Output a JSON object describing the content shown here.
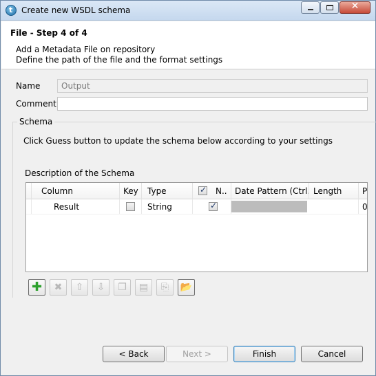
{
  "window": {
    "title": "Create new WSDL schema"
  },
  "header": {
    "title": "File - Step 4 of 4",
    "desc1": "Add a Metadata File on repository",
    "desc2": "Define the path of the file and the format settings"
  },
  "form": {
    "name_label": "Name",
    "name_value": "Output",
    "comment_label": "Comment",
    "comment_value": ""
  },
  "schema": {
    "group_title": "Schema",
    "hint": "Click Guess button to update the schema below according to your settings",
    "desc_label": "Description of the Schema",
    "columns": [
      "Column",
      "Key",
      "Type",
      "N..",
      "Date Pattern (Ctrl...",
      "Length",
      "P"
    ],
    "rows": [
      {
        "column": "Result",
        "key": false,
        "type": "String",
        "nullable": true,
        "date_pattern": "",
        "length": "",
        "precision": "0"
      }
    ]
  },
  "toolbar": {
    "buttons": [
      "add-icon",
      "remove-icon",
      "move-up-icon",
      "move-down-icon",
      "copy-icon",
      "paste-icon",
      "export-icon",
      "import-icon"
    ]
  },
  "buttons": {
    "back": "< Back",
    "next": "Next >",
    "finish": "Finish",
    "cancel": "Cancel"
  }
}
